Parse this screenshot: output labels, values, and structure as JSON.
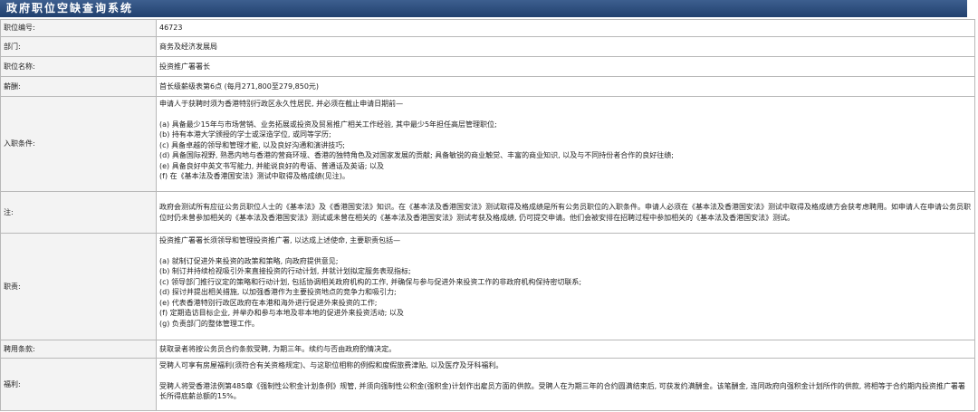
{
  "title": "政府职位空缺查询系统",
  "rows": {
    "post_no": {
      "label": "职位编号:",
      "value": "46723"
    },
    "department": {
      "label": "部门:",
      "value": "商务及经济发展局"
    },
    "post_title": {
      "label": "职位名称:",
      "value": "投资推广署署长"
    },
    "salary": {
      "label": "薪酬:",
      "value": "首长级薪级表第6点 (每月271,800至279,850元)"
    },
    "entry": {
      "label": "入职条件:",
      "intro": "申请人于获聘时须为香港特别行政区永久性居民, 并必须在截止申请日期前—",
      "items": [
        "(a) 具备最少15年与市场营销、业务拓展或投资及贸易推广相关工作经验, 其中最少5年担任高层管理职位;",
        "(b) 持有本港大学颁授的学士或深造学位, 或同等学历;",
        "(c) 具备卓越的领导和管理才能, 以及良好沟通和演讲技巧;",
        "(d) 具备国际视野, 熟悉内地与香港的营商环境、香港的独特角色及对国家发展的贡献; 具备敏锐的商业触觉、丰富的商业知识, 以及与不同持份者合作的良好往绩;",
        "(e) 具备良好中英文书写能力, 并能说良好的粤语、普通话及英语; 以及",
        "(f) 在《基本法及香港国安法》测试中取得及格成绩(见注)。"
      ]
    },
    "note": {
      "label": "注:",
      "text": "政府会测试所有应征公务员职位人士的《基本法》及《香港国安法》知识。在《基本法及香港国安法》测试取得及格成绩是所有公务员职位的入职条件。申请人必须在《基本法及香港国安法》测试中取得及格成绩方会获考虑聘用。如申请人在申请公务员职位时仍未曾参加相关的《基本法及香港国安法》测试或未曾在相关的《基本法及香港国安法》测试考获及格成绩, 仍可提交申请。他们会被安排在招聘过程中参加相关的《基本法及香港国安法》测试。"
    },
    "duties": {
      "label": "职责:",
      "intro": "投资推广署署长须领导和管理投资推广署, 以达成上述使命, 主要职责包括—",
      "items": [
        "(a) 就制订促进外来投资的政策和策略, 向政府提供意见;",
        "(b) 制订并持续检视吸引外来直接投资的行动计划, 并就计划拟定服务表现指标;",
        "(c) 领导部门推行议定的策略和行动计划, 包括协调相关政府机构的工作, 并确保与参与促进外来投资工作的非政府机构保持密切联系;",
        "(d) 探讨并提出相关措施, 以加强香港作为主要投资地点的竞争力和吸引力;",
        "(e) 代表香港特别行政区政府在本港和海外进行促进外来投资的工作;",
        "(f) 定期造访目标企业, 并举办和参与本地及非本地的促进外来投资活动; 以及",
        "(g) 负责部门的整体管理工作。"
      ]
    },
    "terms": {
      "label": "聘用条款:",
      "value": "获取录者将按公务员合约条款受聘, 为期三年。续约与否由政府酌情决定。"
    },
    "benefits": {
      "label": "福利:",
      "p1": "受聘人可享有房屋福利(须符合有关资格规定)、与这职位相称的例假和度假旅费津贴, 以及医疗及牙科福利。",
      "p2": "受聘人将受香港法例第485章《强制性公积金计划条例》规管, 并须向强制性公积金(强积金)计划作出雇员方面的供款。受聘人在为期三年的合约圆满结束后, 可获发约满酬金。该笔酬金, 连同政府向强积金计划所作的供款, 将相等于合约期内投资推广署署长所得底薪总额的15%。"
    }
  }
}
